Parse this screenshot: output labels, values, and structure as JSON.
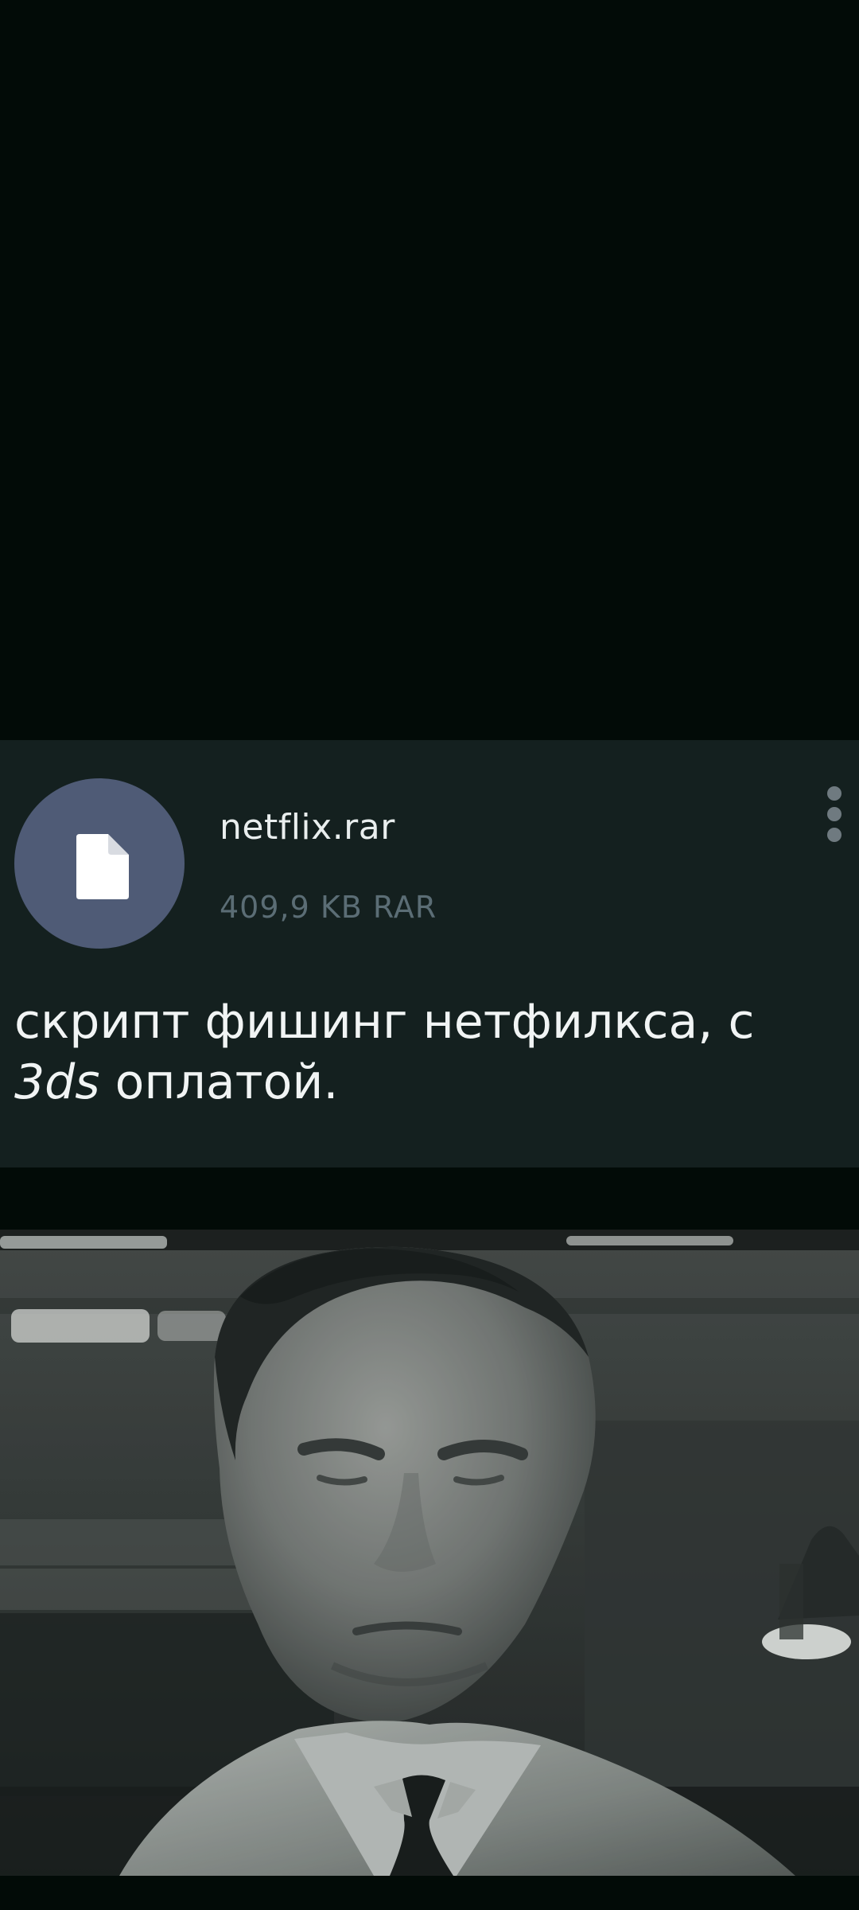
{
  "message": {
    "file": {
      "icon": "file-icon",
      "name": "netflix.rar",
      "meta": "409,9 KB RAR"
    },
    "menu_icon": "more-vertical-icon",
    "caption_prefix": "скрипт фишинг нетфилкса, с ",
    "caption_em": "3ds",
    "caption_suffix": " оплатой."
  },
  "colors": {
    "background": "#020b07",
    "card": "#14201f",
    "avatar": "#4f5b76",
    "primary_text": "#e9eeee",
    "secondary_text": "#5b6d75"
  },
  "scene": {
    "icon": "man-in-office-photo",
    "tone": "desaturated"
  }
}
